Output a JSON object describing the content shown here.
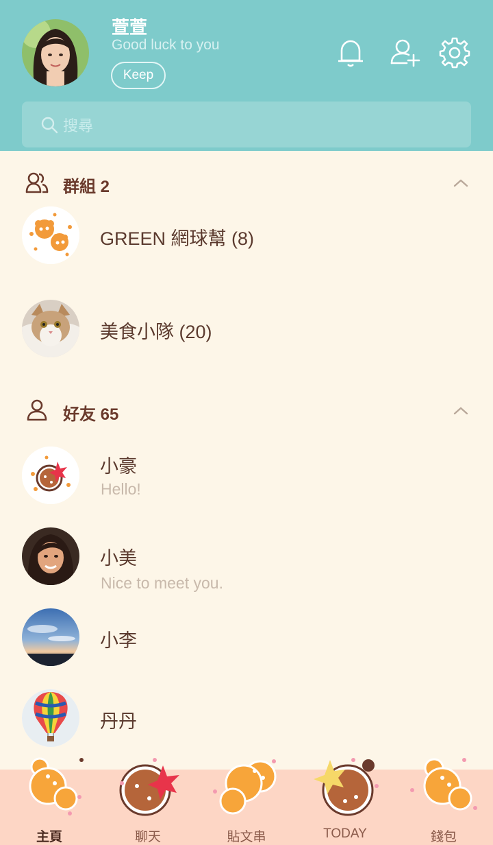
{
  "profile": {
    "name": "萱萱",
    "status": "Good luck to you",
    "keep_label": "Keep"
  },
  "search": {
    "placeholder": "搜尋"
  },
  "groups": {
    "title": "群組 2",
    "items": [
      {
        "name": "GREEN 網球幫 (8)"
      },
      {
        "name": "美食小隊 (20)"
      }
    ]
  },
  "friends": {
    "title": "好友 65",
    "items": [
      {
        "name": "小豪",
        "status": "Hello!"
      },
      {
        "name": "小美",
        "status": "Nice to meet you."
      },
      {
        "name": "小李",
        "status": ""
      },
      {
        "name": "丹丹",
        "status": ""
      }
    ]
  },
  "tabs": [
    {
      "label": "主頁",
      "active": true
    },
    {
      "label": "聊天",
      "active": false
    },
    {
      "label": "貼文串",
      "active": false
    },
    {
      "label": "TODAY",
      "active": false
    },
    {
      "label": "錢包",
      "active": false
    }
  ],
  "colors": {
    "header": "#7ecbcb",
    "background": "#fdf6e8",
    "tabbar": "#fdd6c5",
    "accent_orange": "#f5a030",
    "text_brown": "#5b3a2e"
  },
  "icons": [
    "bell-icon",
    "add-friend-icon",
    "settings-icon",
    "search-icon",
    "group-icon",
    "friend-icon",
    "chevron-up-icon"
  ]
}
